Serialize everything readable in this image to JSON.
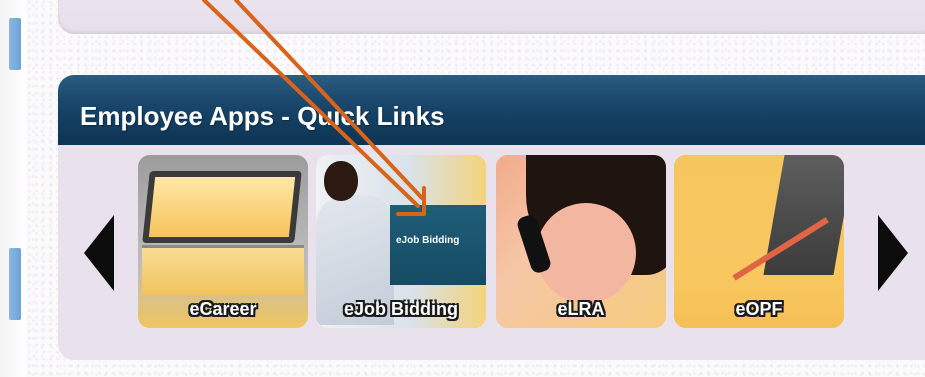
{
  "panel": {
    "title": "Employee Apps - Quick Links"
  },
  "carousel": {
    "prev_icon": "triangle-left",
    "next_icon": "triangle-right",
    "tiles": [
      {
        "label": "eCareer"
      },
      {
        "label": "eJob Bidding",
        "screen_text": "eJob Bidding"
      },
      {
        "label": "eLRA"
      },
      {
        "label": "eOPF"
      }
    ]
  },
  "colors": {
    "header_blue": "#174468",
    "panel_bg": "#e9e1ec",
    "tile_gold": "#f3c56b",
    "annotation_orange": "#d8641c"
  }
}
